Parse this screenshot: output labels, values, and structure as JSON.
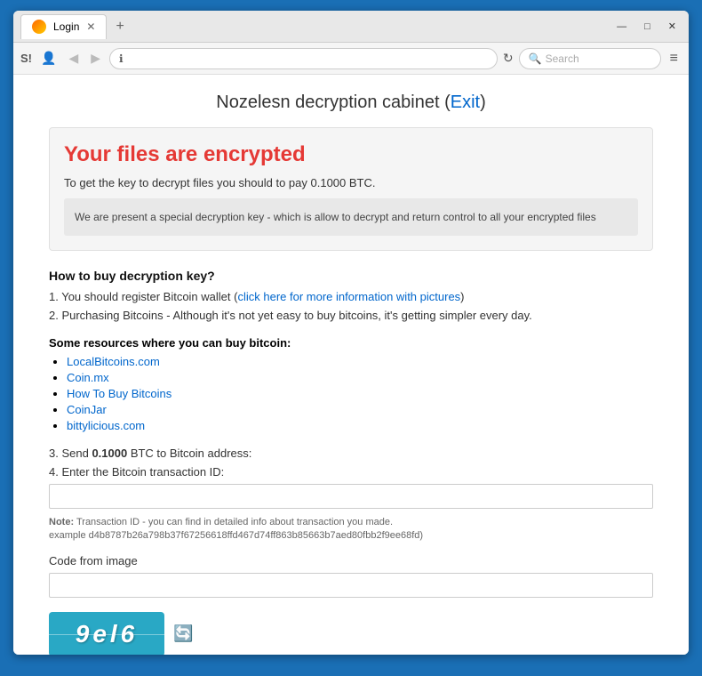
{
  "browser": {
    "tab_label": "Login",
    "new_tab_icon": "+",
    "window_controls": [
      "—",
      "□",
      "✕"
    ],
    "back_disabled": true,
    "info_icon": "ℹ",
    "search_placeholder": "Search",
    "menu_icon": "≡"
  },
  "page": {
    "title_prefix": "Nozelesn decryption cabinet (",
    "exit_label": "Exit",
    "title_suffix": ")",
    "encrypted_heading": "Your files are encrypted",
    "decrypt_instruction": "To get the key to decrypt files you should to pay 0.1000 BTC.",
    "key_info": "We are present a special decryption key - which is allow to decrypt and return control to all your encrypted files",
    "how_to_heading": "How to buy decryption key?",
    "steps": [
      "1. You should register Bitcoin wallet (click here for more information with pictures)",
      "2. Purchasing Bitcoins - Although it's not yet easy to buy bitcoins, it's getting simpler every day."
    ],
    "step1_prefix": "1. You should register Bitcoin wallet (",
    "step1_link": "click here for more information with pictures",
    "step1_suffix": ")",
    "step2": "2. Purchasing Bitcoins - Although it's not yet easy to buy bitcoins, it's getting simpler every day.",
    "resources_label": "Some resources where you can buy bitcoin:",
    "resources": [
      {
        "label": "LocalBitcoins.com",
        "url": "#"
      },
      {
        "label": "Coin.mx",
        "url": "#"
      },
      {
        "label": "How To Buy Bitcoins",
        "url": "#"
      },
      {
        "label": "CoinJar",
        "url": "#"
      },
      {
        "label": "bittylicious.com",
        "url": "#"
      }
    ],
    "step3": "3. Send ",
    "step3_bold": "0.1000",
    "step3_suffix": " BTC to Bitcoin address:",
    "step4": "4. Enter the Bitcoin transaction ID:",
    "transaction_placeholder": "",
    "note_label": "Note:",
    "note_text": "Transaction ID - you can find in detailed info about transaction you made.",
    "note_example": "example d4b8787b26a798b37f67256618ffd467d74ff863b85663b7aed80fbb2f9ee68fd)",
    "code_from_image": "Code from image",
    "captcha_text": "9el6",
    "captcha_refresh_icon": "🔄"
  }
}
